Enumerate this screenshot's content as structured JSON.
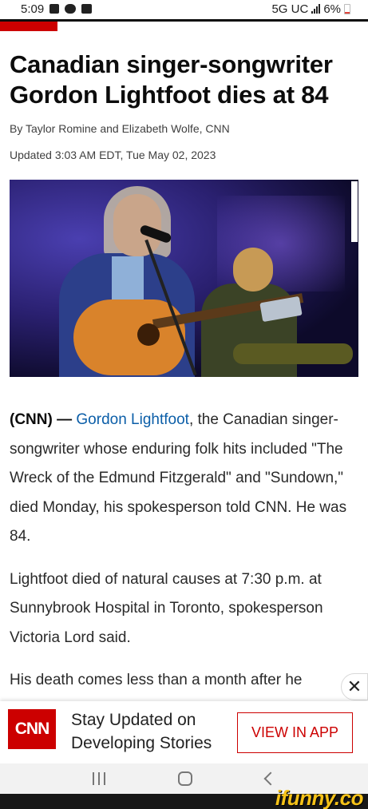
{
  "status_bar": {
    "time": "5:09",
    "network": "5G UC",
    "battery": "6%",
    "left_icons": [
      "notification-icon",
      "voicemail-icon",
      "gallery-icon"
    ]
  },
  "brand": {
    "accent": "#cc0000",
    "link": "#0b5ea8"
  },
  "article": {
    "headline": "Canadian singer-songwriter Gordon Lightfoot dies at 84",
    "byline": "By Taylor Romine and Elizabeth Wolfe, CNN",
    "updated": "Updated 3:03 AM EDT, Tue May 02, 2023",
    "hero_image": "Gordon Lightfoot performing with guitar and microphone on stage",
    "p1_source": "(CNN) —",
    "p1_link": "Gordon Lightfoot",
    "p1_rest": ", the Canadian singer-songwriter whose enduring folk hits included \"The Wreck of the Edmund Fitzgerald\" and \"Sundown,\" died Monday, his spokesperson told CNN. He was 84.",
    "p2": "Lightfoot died of natural causes at 7:30 p.m. at Sunnybrook Hospital in Toronto, spokesperson Victoria Lord said.",
    "p3": "His death comes less than a month after he"
  },
  "app_banner": {
    "logo": "CNN",
    "message": "Stay Updated on Developing Stories",
    "cta": "VIEW IN APP",
    "close_icon": "close-icon"
  },
  "nav": {
    "buttons": [
      "recents-icon",
      "home-icon",
      "back-icon"
    ]
  },
  "watermark": "ifunny.co"
}
